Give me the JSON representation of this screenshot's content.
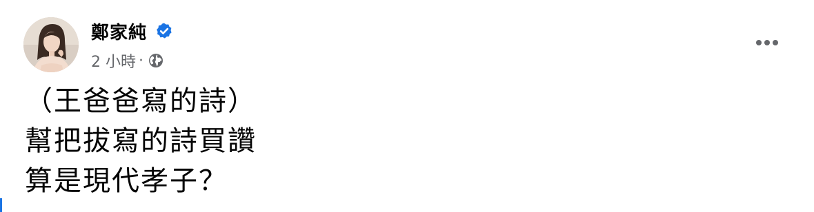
{
  "post": {
    "author_name": "鄭家純",
    "timestamp": "2 小時",
    "meta_separator": "·",
    "audience_icon": "globe-icon",
    "verified_icon": "verified-badge-icon",
    "more_icon": "more-options-icon",
    "lines": [
      "（王爸爸寫的詩）",
      "幫把拔寫的詩買讚",
      "算是現代孝子？"
    ]
  },
  "colors": {
    "verified_blue": "#1b74e4",
    "meta_gray": "#65676b",
    "text_black": "#050505"
  }
}
